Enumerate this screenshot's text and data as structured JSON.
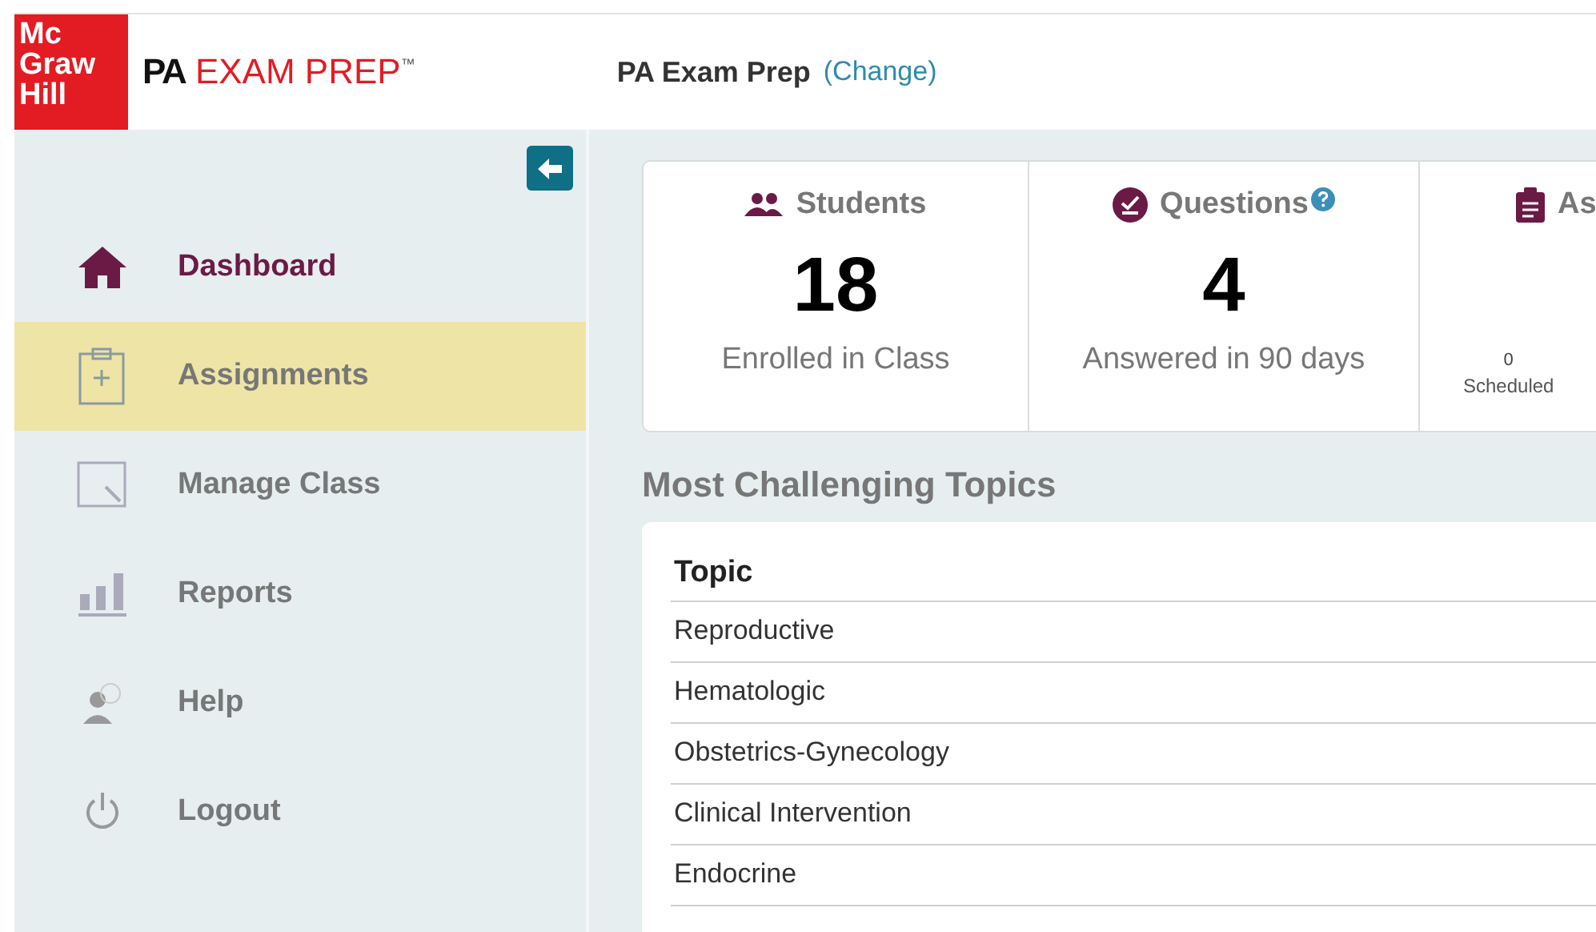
{
  "logo": {
    "brand_lines": [
      "Mc",
      "Graw",
      "Hill"
    ],
    "product_bold": "PA",
    "product": "EXAM PREP",
    "trademark": "™"
  },
  "header": {
    "title": "PA Exam Prep",
    "link": "(Change)"
  },
  "sidebar": {
    "items": [
      {
        "label": "Dashboard",
        "selected": true,
        "highlighted": false
      },
      {
        "label": "Assignments",
        "selected": false,
        "highlighted": true
      },
      {
        "label": "Manage Class",
        "selected": false,
        "highlighted": false
      },
      {
        "label": "Reports",
        "selected": false,
        "highlighted": false
      },
      {
        "label": "Help",
        "selected": false,
        "highlighted": false
      },
      {
        "label": "Logout",
        "selected": false,
        "highlighted": false
      }
    ]
  },
  "stats": [
    {
      "kind": "big",
      "title": "Students",
      "value": "18",
      "caption": "Enrolled in Class"
    },
    {
      "kind": "big",
      "title": "Questions",
      "help": true,
      "value": "4",
      "caption": "Answered in 90 days"
    },
    {
      "kind": "small",
      "title": "As",
      "value": "0",
      "caption": "Scheduled"
    }
  ],
  "topics": {
    "title": "Most Challenging Topics",
    "columns": [
      "Topic"
    ],
    "rows": [
      "Reproductive",
      "Hematologic",
      "Obstetrics-Gynecology",
      "Clinical Intervention",
      "Endocrine"
    ]
  }
}
